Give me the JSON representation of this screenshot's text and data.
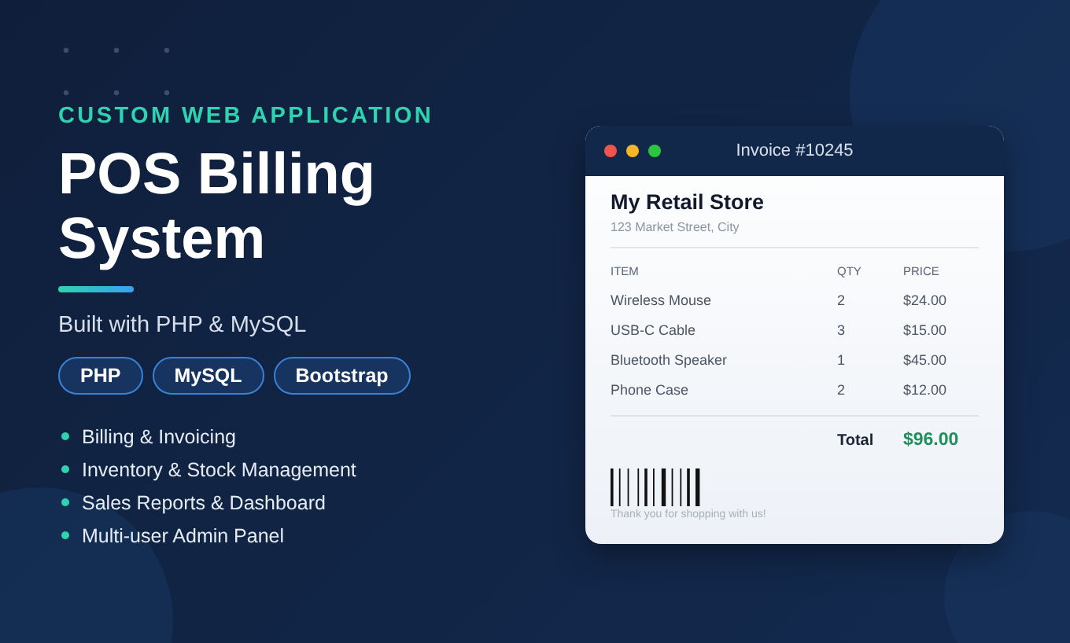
{
  "eyebrow": "CUSTOM WEB APPLICATION",
  "title_lines": [
    "POS Billing",
    "System"
  ],
  "subtitle": "Built with PHP & MySQL",
  "tags": [
    "PHP",
    "MySQL",
    "Bootstrap"
  ],
  "features": [
    "Billing & Invoicing",
    "Inventory & Stock Management",
    "Sales Reports & Dashboard",
    "Multi-user Admin Panel"
  ],
  "invoice": {
    "window_title": "Invoice #10245",
    "store_name": "My Retail Store",
    "store_address": "123 Market Street, City",
    "columns": [
      "ITEM",
      "QTY",
      "PRICE"
    ],
    "rows": [
      {
        "item": "Wireless Mouse",
        "qty": "2",
        "price": "$24.00"
      },
      {
        "item": "USB-C Cable",
        "qty": "3",
        "price": "$15.00"
      },
      {
        "item": "Bluetooth Speaker",
        "qty": "1",
        "price": "$45.00"
      },
      {
        "item": "Phone Case",
        "qty": "2",
        "price": "$12.00"
      }
    ],
    "total_label": "Total",
    "total_value": "$96.00",
    "footer_note": "Thank you for shopping with us!"
  }
}
